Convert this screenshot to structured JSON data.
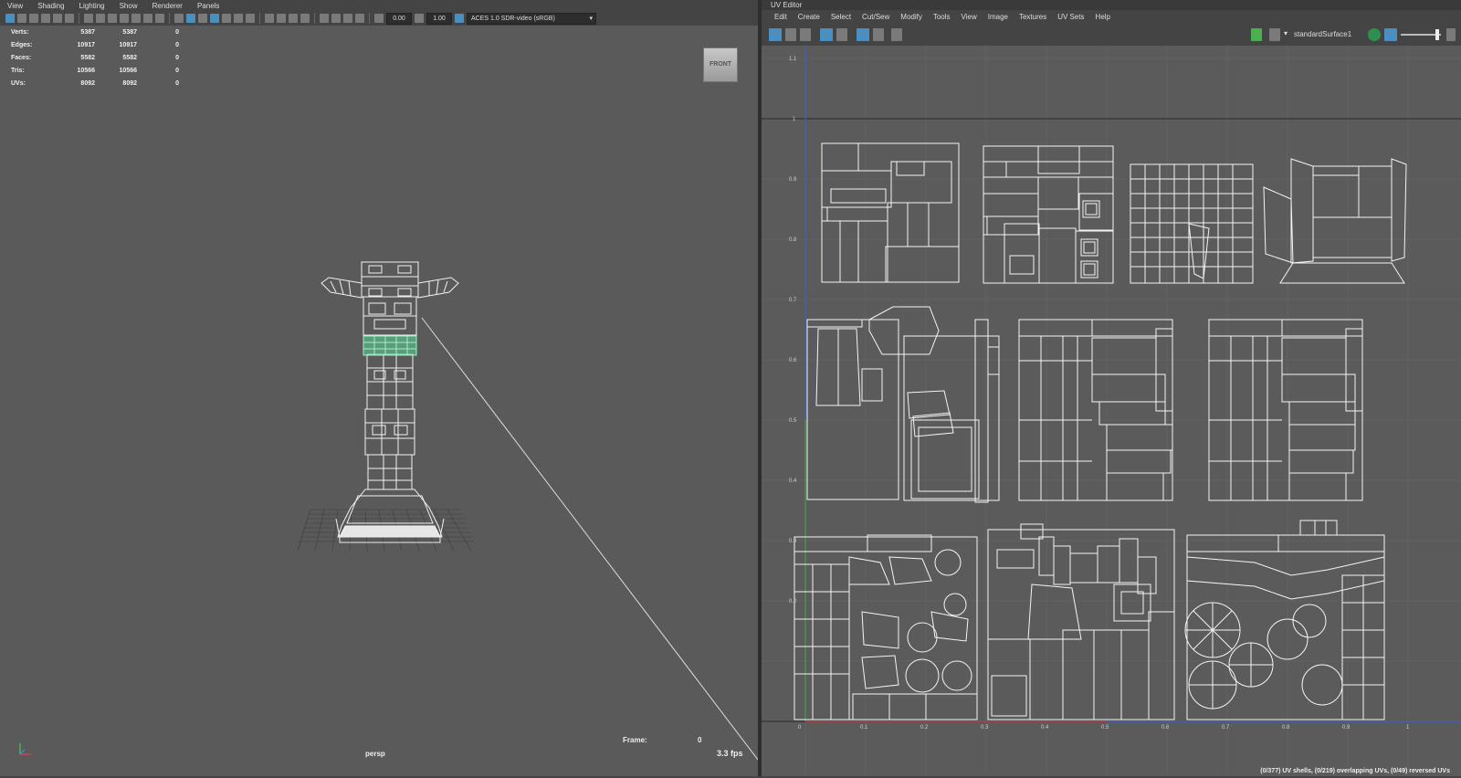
{
  "left_menu": [
    "View",
    "Shading",
    "Lighting",
    "Show",
    "Renderer",
    "Panels"
  ],
  "viewport_toolbar": {
    "exposure_value": "0.00",
    "gamma_value": "1.00",
    "color_management": "ACES 1.0 SDR-video (sRGB)"
  },
  "stats": [
    {
      "label": "Verts:",
      "v1": "5387",
      "v2": "5387",
      "v3": "0"
    },
    {
      "label": "Edges:",
      "v1": "10917",
      "v2": "10917",
      "v3": "0"
    },
    {
      "label": "Faces:",
      "v1": "5582",
      "v2": "5582",
      "v3": "0"
    },
    {
      "label": "Tris:",
      "v1": "10566",
      "v2": "10566",
      "v3": "0"
    },
    {
      "label": "UVs:",
      "v1": "8092",
      "v2": "8092",
      "v3": "0"
    }
  ],
  "viewcube_label": "FRONT",
  "frame_label": "Frame:",
  "frame_value": "0",
  "camera_name": "persp",
  "fps": "3.3 fps",
  "uv_editor": {
    "title": "UV Editor",
    "menu": [
      "Edit",
      "Create",
      "Select",
      "Cut/Sew",
      "Modify",
      "Tools",
      "View",
      "Image",
      "Textures",
      "UV Sets",
      "Help"
    ],
    "shader_name": "standardSurface1",
    "status": "(0/377) UV shells, (0/219) overlapping UVs, (0/49) reversed UVs",
    "y_ticks": [
      "1.1",
      "1",
      "0.9",
      "0.8",
      "0.7",
      "0.6",
      "0.5",
      "0.4",
      "0.3",
      "0.2"
    ],
    "x_ticks": [
      "0",
      "0.1",
      "0.2",
      "0.3",
      "0.4",
      "0.5",
      "0.6",
      "0.7",
      "0.8",
      "0.9",
      "1"
    ]
  },
  "colors": {
    "viewport_bg": "#5a5a5a",
    "uv_bg": "#5b5b5b",
    "selection_green": "#5fd49a",
    "accent_blue": "#4a8fc0"
  }
}
